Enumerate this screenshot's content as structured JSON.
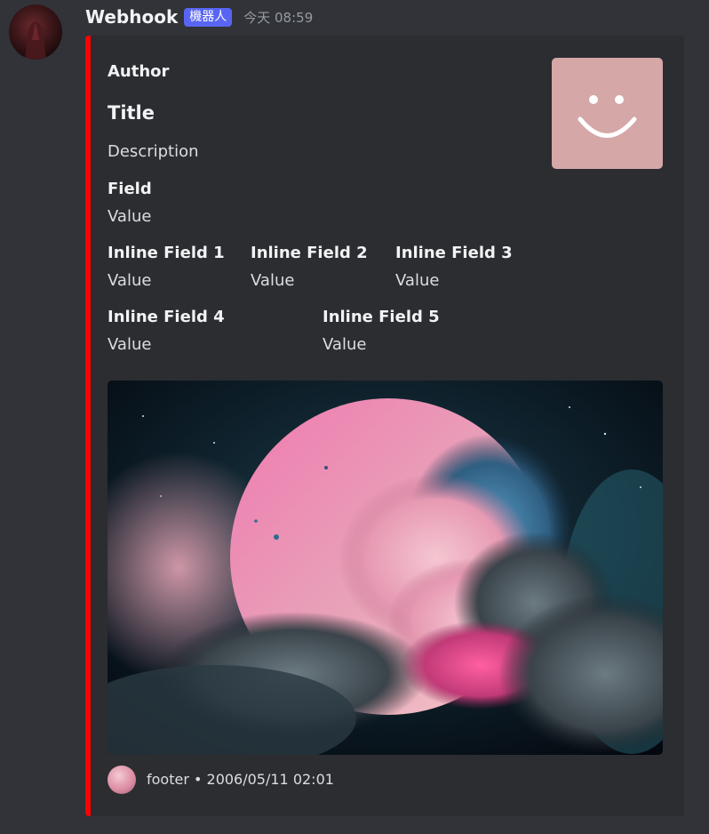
{
  "message": {
    "username": "Webhook",
    "badge": "機器人",
    "timestamp": "今天 08:59"
  },
  "embed": {
    "color": "#ff0000",
    "author": "Author",
    "title": "Title",
    "description": "Description",
    "fields": [
      {
        "name": "Field",
        "value": "Value"
      },
      {
        "name": "Inline Field 1",
        "value": "Value"
      },
      {
        "name": "Inline Field 2",
        "value": "Value"
      },
      {
        "name": "Inline Field 3",
        "value": "Value"
      },
      {
        "name": "Inline Field 4",
        "value": "Value"
      },
      {
        "name": "Inline Field 5",
        "value": "Value"
      }
    ],
    "thumbnail_icon": "smiley-face-icon",
    "footer": {
      "icon": "footer-avatar-icon",
      "text": "footer • 2006/05/11 02:01"
    }
  }
}
